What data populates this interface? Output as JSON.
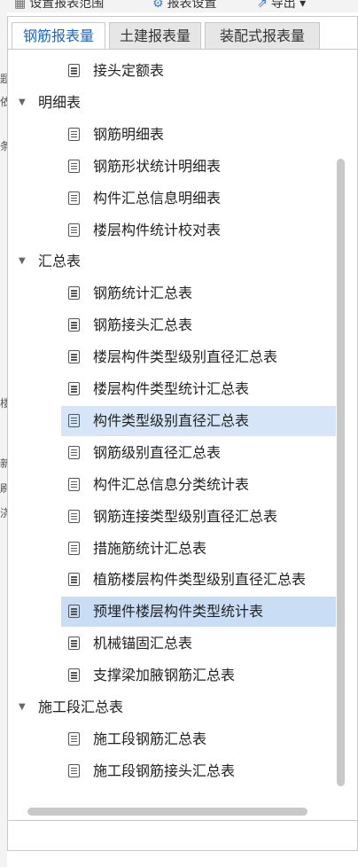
{
  "toolbar": {
    "set_scope": "设置报表范围",
    "report_settings": "报表设置",
    "export": "导出"
  },
  "tabs": [
    {
      "label": "钢筋报表量",
      "active": true
    },
    {
      "label": "土建报表量",
      "active": false
    },
    {
      "label": "装配式报表量",
      "active": false
    }
  ],
  "tree": [
    {
      "type": "leaf",
      "label": "接头定额表"
    },
    {
      "type": "folder",
      "label": "明细表",
      "expanded": true
    },
    {
      "type": "leaf",
      "label": "钢筋明细表"
    },
    {
      "type": "leaf",
      "label": "钢筋形状统计明细表"
    },
    {
      "type": "leaf",
      "label": "构件汇总信息明细表"
    },
    {
      "type": "leaf",
      "label": "楼层构件统计校对表"
    },
    {
      "type": "folder",
      "label": "汇总表",
      "expanded": true
    },
    {
      "type": "leaf",
      "label": "钢筋统计汇总表"
    },
    {
      "type": "leaf",
      "label": "钢筋接头汇总表"
    },
    {
      "type": "leaf",
      "label": "楼层构件类型级别直径汇总表"
    },
    {
      "type": "leaf",
      "label": "楼层构件类型统计汇总表"
    },
    {
      "type": "leaf",
      "label": "构件类型级别直径汇总表",
      "hover": true
    },
    {
      "type": "leaf",
      "label": "钢筋级别直径汇总表"
    },
    {
      "type": "leaf",
      "label": "构件汇总信息分类统计表"
    },
    {
      "type": "leaf",
      "label": "钢筋连接类型级别直径汇总表"
    },
    {
      "type": "leaf",
      "label": "措施筋统计汇总表"
    },
    {
      "type": "leaf",
      "label": "植筋楼层构件类型级别直径汇总表"
    },
    {
      "type": "leaf",
      "label": "预埋件楼层构件类型统计表",
      "selected": true
    },
    {
      "type": "leaf",
      "label": "机械锚固汇总表"
    },
    {
      "type": "leaf",
      "label": "支撑梁加腋钢筋汇总表"
    },
    {
      "type": "folder",
      "label": "施工段汇总表",
      "expanded": true
    },
    {
      "type": "leaf",
      "label": "施工段钢筋汇总表"
    },
    {
      "type": "leaf",
      "label": "施工段钢筋接头汇总表"
    }
  ],
  "left_fragments": [
    "题",
    "依",
    "条",
    "楼",
    "新",
    "刷",
    "浇"
  ]
}
